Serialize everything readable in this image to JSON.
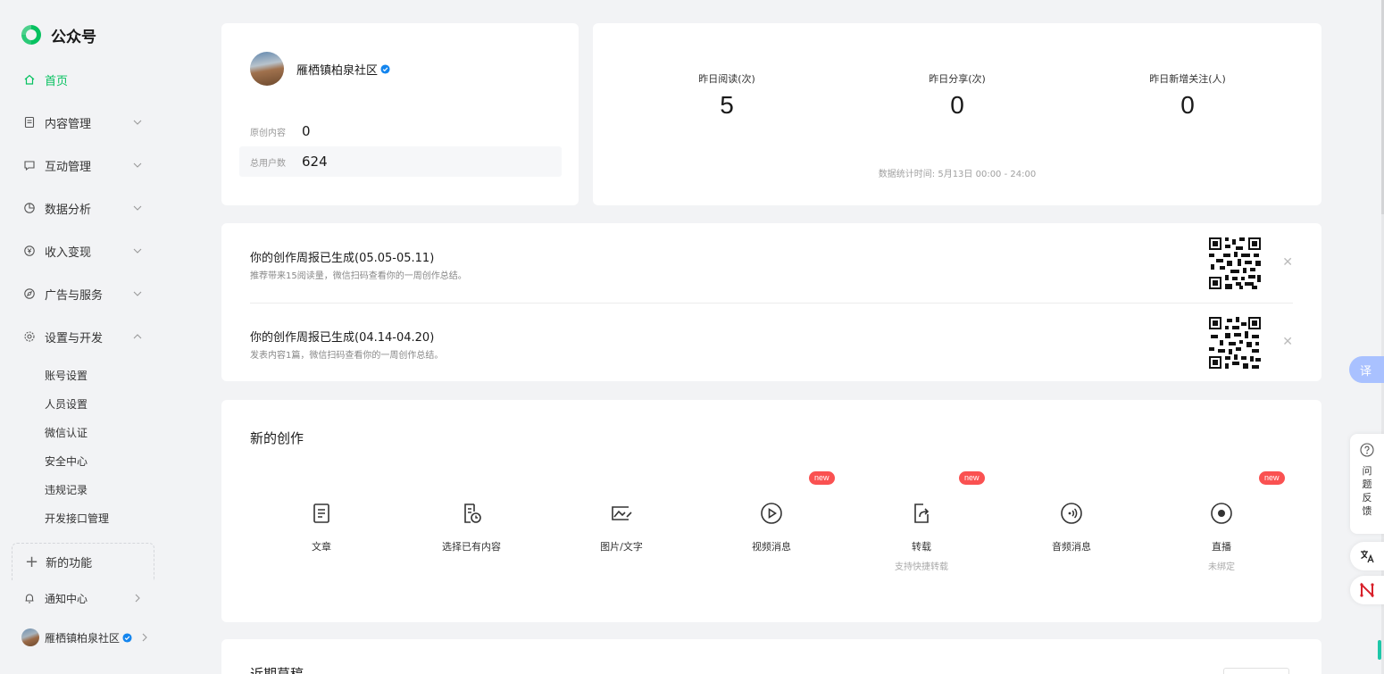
{
  "app": {
    "title": "公众号"
  },
  "sidebar": {
    "items": [
      {
        "label": "首页",
        "icon": "home-icon",
        "active": true
      },
      {
        "label": "内容管理",
        "icon": "document-icon"
      },
      {
        "label": "互动管理",
        "icon": "chat-icon"
      },
      {
        "label": "数据分析",
        "icon": "pie-chart-icon"
      },
      {
        "label": "收入变现",
        "icon": "yen-icon"
      },
      {
        "label": "广告与服务",
        "icon": "compass-icon"
      },
      {
        "label": "设置与开发",
        "icon": "gear-icon",
        "expanded": true
      }
    ],
    "subitems": [
      "账号设置",
      "人员设置",
      "微信认证",
      "安全中心",
      "违规记录",
      "开发接口管理"
    ],
    "new_feature": "新的功能",
    "notifications": "通知中心",
    "account_name": "雁栖镇柏泉社区"
  },
  "profile": {
    "name": "雁栖镇柏泉社区",
    "original_label": "原创内容",
    "original_value": "0",
    "users_label": "总用户数",
    "users_value": "624"
  },
  "stats": {
    "reads_label": "昨日阅读(次)",
    "reads_value": "5",
    "shares_label": "昨日分享(次)",
    "shares_value": "0",
    "follows_label": "昨日新增关注(人)",
    "follows_value": "0",
    "footer": "数据统计时间: 5月13日 00:00 - 24:00"
  },
  "reports": [
    {
      "title": "你的创作周报已生成(05.05-05.11)",
      "desc": "推荐带来15阅读量，微信扫码查看你的一周创作总结。"
    },
    {
      "title": "你的创作周报已生成(04.14-04.20)",
      "desc": "发表内容1篇，微信扫码查看你的一周创作总结。"
    }
  ],
  "create": {
    "title": "新的创作",
    "badge": "new",
    "tools": [
      {
        "label": "文章",
        "sub": "",
        "icon": "article-icon"
      },
      {
        "label": "选择已有内容",
        "sub": "",
        "icon": "existing-content-icon"
      },
      {
        "label": "图片/文字",
        "sub": "",
        "icon": "image-text-icon"
      },
      {
        "label": "视频消息",
        "sub": "",
        "icon": "video-icon",
        "new": true
      },
      {
        "label": "转载",
        "sub": "支持快捷转载",
        "icon": "repost-icon",
        "new": true
      },
      {
        "label": "音频消息",
        "sub": "",
        "icon": "audio-icon"
      },
      {
        "label": "直播",
        "sub": "未绑定",
        "icon": "live-icon",
        "new": true
      }
    ]
  },
  "drafts": {
    "title": "近期草稿"
  },
  "floating": {
    "translate": "译",
    "feedback": "问题反馈"
  },
  "colors": {
    "accent": "#07c160",
    "badge": "#fa5151",
    "verified": "#1485ee",
    "background": "#f2f3f5"
  }
}
